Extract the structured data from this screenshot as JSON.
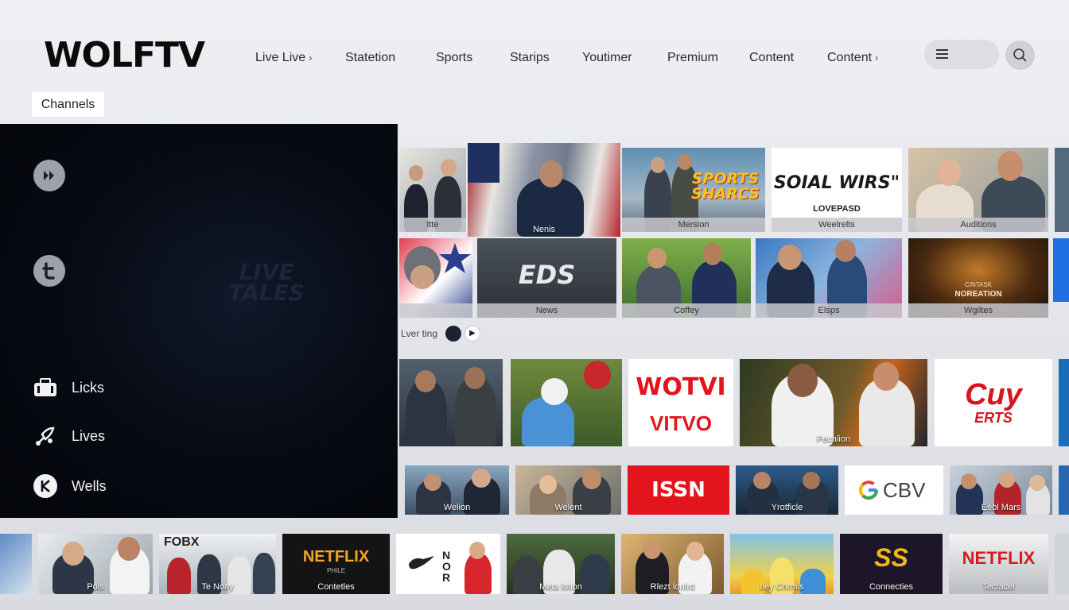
{
  "app": {
    "logo": "WOLFTV"
  },
  "nav": [
    {
      "label": "Live Live",
      "chevron": true
    },
    {
      "label": "Statetion",
      "chevron": false
    },
    {
      "label": "Sports",
      "chevron": false
    },
    {
      "label": "Starips",
      "chevron": false
    },
    {
      "label": "Youtimer",
      "chevron": false
    },
    {
      "label": "Premium",
      "chevron": false
    },
    {
      "label": "Content",
      "chevron": false
    },
    {
      "label": "Content",
      "chevron": true
    }
  ],
  "header_icons": {
    "menu": "hamburger-icon",
    "search": "search-icon"
  },
  "channels_label": "Channels",
  "panel": {
    "watermark": "LIVE TALES",
    "top_icons": [
      "fast-forward-icon",
      "t-circle-icon"
    ],
    "items": [
      {
        "label": "Licks",
        "icon": "camera-bag-icon"
      },
      {
        "label": "Lives",
        "icon": "satellite-icon"
      },
      {
        "label": "Wells",
        "icon": "k-circle-icon"
      }
    ]
  },
  "row1": [
    {
      "caption": "ltte"
    },
    {
      "caption": "Nenis"
    },
    {
      "caption": "Mersion",
      "brand": "SPORTS SHARCS"
    },
    {
      "caption": "Weelrelts",
      "brand": "SOIAL WIRS\"",
      "sub": "LOVEPASD"
    },
    {
      "caption": "Auditions"
    }
  ],
  "row2": [
    {
      "caption": ""
    },
    {
      "caption": "News",
      "brand": "EDS"
    },
    {
      "caption": "Coffey"
    },
    {
      "caption": "Elsps"
    },
    {
      "caption": "Wgiltes",
      "brand": "CINTASK",
      "sub": "NOREATION"
    }
  ],
  "living_label": "Lver  ting",
  "row3": [
    {
      "caption": ""
    },
    {
      "caption": ""
    },
    {
      "caption": "",
      "brand": "WOTVI",
      "sub": "VITVO"
    },
    {
      "caption": "Pecalion"
    },
    {
      "caption": "",
      "brand": "Cuy",
      "sub": "ERTS"
    }
  ],
  "row4": [
    {
      "caption": "Welion"
    },
    {
      "caption": "Welent"
    },
    {
      "caption": "",
      "brand": "ISSN"
    },
    {
      "caption": "Yrotficle"
    },
    {
      "caption": "",
      "brand": "CBV"
    },
    {
      "caption": "Eebl Mars"
    }
  ],
  "row5": [
    {
      "caption": ""
    },
    {
      "caption": "Pols"
    },
    {
      "caption": "Te Noay",
      "brand": "FOBX"
    },
    {
      "caption": "Contetles",
      "brand": "NETFLIX",
      "sub": "PHILE"
    },
    {
      "caption": "",
      "brand": "NOR"
    },
    {
      "caption": "Meta lotion"
    },
    {
      "caption": "Rlezt lonfrd"
    },
    {
      "caption": "Iley Chrmis"
    },
    {
      "caption": "Connecties",
      "brand": "SS"
    },
    {
      "caption": "Tecfacel",
      "brand": "NETFLIX"
    }
  ],
  "colors": {
    "background": "#e8eaee",
    "panel": "#05070c",
    "accent_red": "#e4141d",
    "netflix_orange": "#f5a623"
  }
}
